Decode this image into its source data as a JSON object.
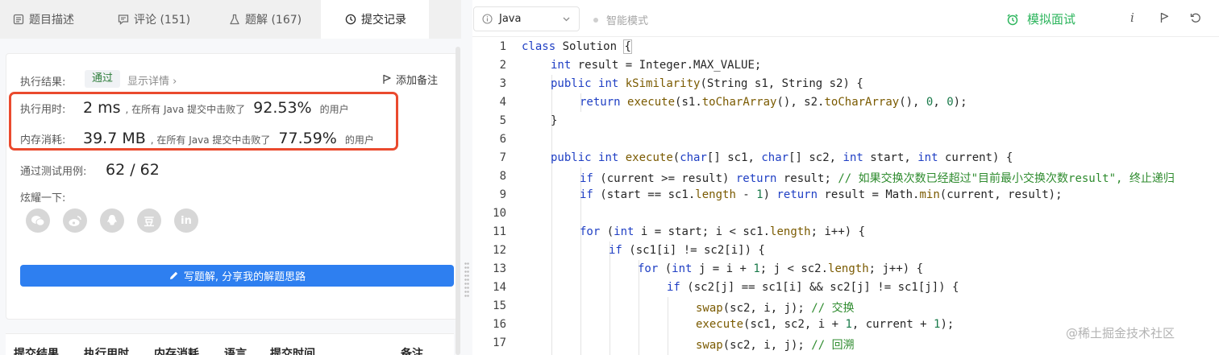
{
  "tabs": [
    {
      "label": "题目描述",
      "icon": "description-icon"
    },
    {
      "label": "评论 (151)",
      "icon": "comment-icon"
    },
    {
      "label": "题解 (167)",
      "icon": "flask-icon"
    },
    {
      "label": "提交记录",
      "icon": "clock-icon"
    }
  ],
  "result": {
    "label": "执行结果:",
    "status": "通过",
    "detail_link": "显示详情 ›",
    "add_note": "添加备注",
    "time_label": "执行用时:",
    "time_value": "2 ms",
    "time_text": ", 在所有 Java 提交中击败了",
    "time_percent": "92.53%",
    "time_suffix": "的用户",
    "mem_label": "内存消耗:",
    "mem_value": "39.7 MB",
    "mem_text": ", 在所有 Java 提交中击败了",
    "mem_percent": "77.59%",
    "mem_suffix": "的用户",
    "tests_label": "通过测试用例:",
    "tests_value": "62 / 62",
    "share_label": "炫耀一下:",
    "share_icons": [
      "wechat-icon",
      "weibo-icon",
      "qq-icon",
      "douban-icon",
      "linkedin-icon"
    ],
    "douban_glyph": "豆",
    "linkedin_glyph": "in",
    "write_button": "写题解, 分享我的解题思路"
  },
  "submission_table": {
    "headers": [
      "提交结果",
      "执行用时",
      "内存消耗",
      "语言",
      "提交时间",
      "备注"
    ]
  },
  "toolbar": {
    "language": "Java",
    "smart_mode": "智能模式",
    "mock_interview": "模拟面试",
    "info_glyph": "i",
    "accent": "#2db55d"
  },
  "code": {
    "lines": [
      {
        "n": "1"
      },
      {
        "n": "2"
      },
      {
        "n": "3"
      },
      {
        "n": "4"
      },
      {
        "n": "5"
      },
      {
        "n": "6"
      },
      {
        "n": "7"
      },
      {
        "n": "8"
      },
      {
        "n": "9"
      },
      {
        "n": "10"
      },
      {
        "n": "11"
      },
      {
        "n": "12"
      },
      {
        "n": "13"
      },
      {
        "n": "14"
      },
      {
        "n": "15"
      },
      {
        "n": "16"
      },
      {
        "n": "17"
      }
    ],
    "t": {
      "l1a": "class",
      "l1b": " Solution ",
      "l1c": "{",
      "l2a": "int",
      "l2b": " result = Integer.MAX_VALUE;",
      "l3a": "public",
      "l3b": " ",
      "l3c": "int",
      "l3d": " ",
      "l3e": "kSimilarity",
      "l3f": "(String s1, String s2) {",
      "l4a": "return",
      "l4b": " ",
      "l4c": "execute",
      "l4d": "(s1.",
      "l4e": "toCharArray",
      "l4f": "(), s2.",
      "l4g": "toCharArray",
      "l4h": "(), ",
      "l4i": "0",
      "l4j": ", ",
      "l4k": "0",
      "l4l": ");",
      "l5": "}",
      "l7a": "public",
      "l7b": " ",
      "l7c": "int",
      "l7d": " ",
      "l7e": "execute",
      "l7f": "(",
      "l7g": "char",
      "l7h": "[] sc1, ",
      "l7i": "char",
      "l7j": "[] sc2, ",
      "l7k": "int",
      "l7l": " start, ",
      "l7m": "int",
      "l7n": " current) {",
      "l8a": "if",
      "l8b": " (current >= result) ",
      "l8c": "return",
      "l8d": " result; ",
      "l8e": "// 如果交换次数已经超过\"目前最小交换次数result\", 终止递归",
      "l9a": "if",
      "l9b": " (start == sc1.",
      "l9c": "length",
      "l9d": " - ",
      "l9e": "1",
      "l9f": ") ",
      "l9g": "return",
      "l9h": " result = Math.",
      "l9i": "min",
      "l9j": "(current, result);",
      "l11a": "for",
      "l11b": " (",
      "l11c": "int",
      "l11d": " i = start; i < sc1.",
      "l11e": "length",
      "l11f": "; i++) {",
      "l12a": "if",
      "l12b": " (sc1[i] != sc2[i]) {",
      "l13a": "for",
      "l13b": " (",
      "l13c": "int",
      "l13d": " j = i + ",
      "l13e": "1",
      "l13f": "; j < sc2.",
      "l13g": "length",
      "l13h": "; j++) {",
      "l14a": "if",
      "l14b": " (sc2[j] == sc1[i] && sc2[j] != sc1[j]) {",
      "l15a": "swap",
      "l15b": "(sc2, i, j); ",
      "l15c": "// 交换",
      "l16a": "execute",
      "l16b": "(sc1, sc2, i + ",
      "l16c": "1",
      "l16d": ", current + ",
      "l16e": "1",
      "l16f": ");",
      "l17a": "swap",
      "l17b": "(sc2, i, j); ",
      "l17c": "// 回溯"
    }
  },
  "watermark": "@稀土掘金技术社区"
}
